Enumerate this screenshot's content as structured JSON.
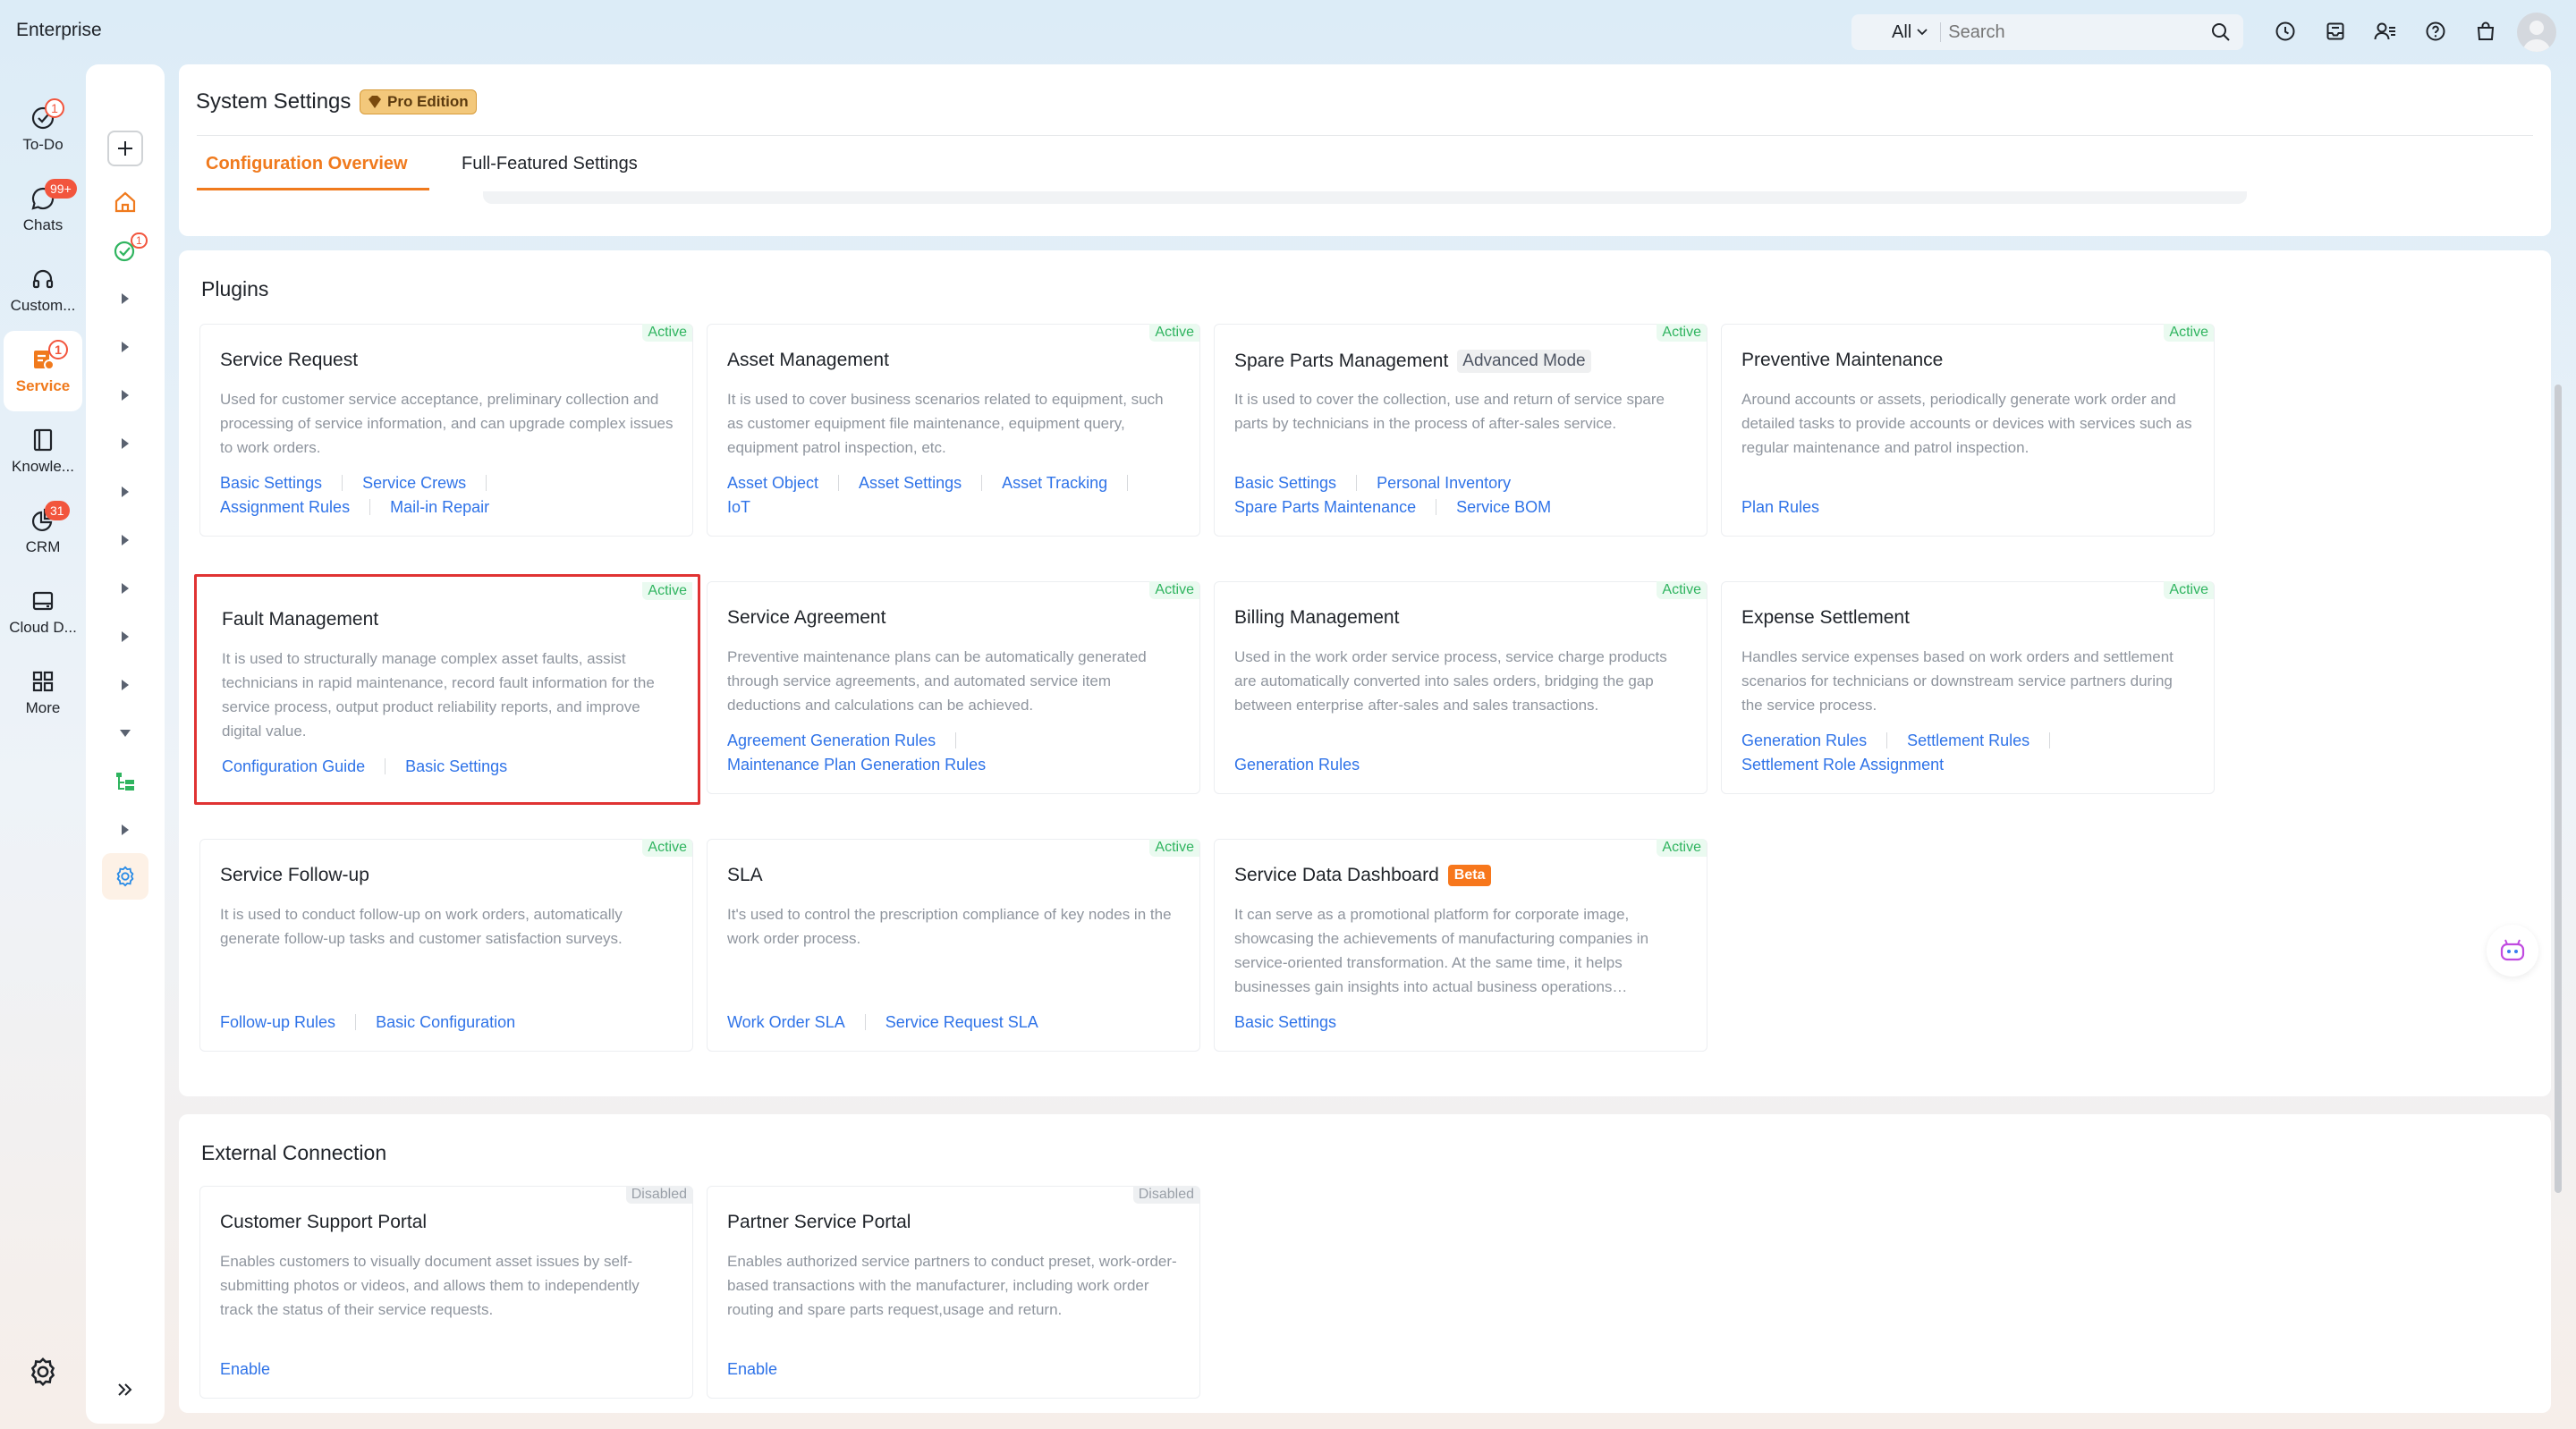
{
  "app": {
    "brand": "Enterprise"
  },
  "search": {
    "scope": "All",
    "placeholder": "Search"
  },
  "nav": {
    "items": [
      {
        "label": "To-Do",
        "badge": "1"
      },
      {
        "label": "Chats",
        "badge": "99+"
      },
      {
        "label": "Custom...",
        "badge": ""
      },
      {
        "label": "Service",
        "badge": "1"
      },
      {
        "label": "Knowle...",
        "badge": ""
      },
      {
        "label": "CRM",
        "badge": "31"
      },
      {
        "label": "Cloud D...",
        "badge": ""
      },
      {
        "label": "More",
        "badge": ""
      }
    ]
  },
  "sidebar2": {
    "todo_badge": "1"
  },
  "page": {
    "title": "System Settings",
    "edition": "Pro Edition",
    "tabs": [
      "Configuration Overview",
      "Full-Featured Settings"
    ]
  },
  "plugins": {
    "title": "Plugins",
    "status_active": "Active",
    "tiles": [
      {
        "title": "Service Request",
        "desc": "Used for customer service acceptance, preliminary collection and processing of service information, and can upgrade complex issues to work orders.",
        "links": [
          "Basic Settings",
          "Service Crews",
          "Assignment Rules",
          "Mail-in Repair"
        ]
      },
      {
        "title": "Asset Management",
        "desc": "It is used to cover business scenarios related to equipment, such as customer equipment file maintenance, equipment query, equipment patrol inspection, etc.",
        "links": [
          "Asset Object",
          "Asset Settings",
          "Asset Tracking",
          "IoT"
        ]
      },
      {
        "title": "Spare Parts Management",
        "mode": "Advanced Mode",
        "desc": "It is used to cover the collection, use and return of service spare parts by technicians in the process of after-sales service.",
        "links": [
          "Basic Settings",
          "Personal Inventory",
          "Spare Parts Maintenance",
          "Service BOM"
        ]
      },
      {
        "title": "Preventive Maintenance",
        "desc": "Around accounts or assets, periodically generate work order and detailed tasks to provide accounts or devices with services such as regular maintenance and patrol inspection.",
        "links": [
          "Plan Rules"
        ]
      },
      {
        "title": "Fault Management",
        "desc": "It is used to structurally manage complex asset faults, assist technicians in rapid maintenance, record fault information for the service process, output product reliability reports, and improve digital value.",
        "links": [
          "Configuration Guide",
          "Basic Settings"
        ]
      },
      {
        "title": "Service Agreement",
        "desc": "Preventive maintenance plans can be automatically generated through service agreements, and automated service item deductions and calculations can be achieved.",
        "links": [
          "Agreement Generation Rules",
          "Maintenance Plan Generation Rules"
        ]
      },
      {
        "title": "Billing Management",
        "desc": "Used in the work order service process, service charge products are automatically converted into sales orders, bridging the gap between enterprise after-sales and sales transactions.",
        "links": [
          "Generation Rules"
        ]
      },
      {
        "title": "Expense Settlement",
        "desc": "Handles service expenses based on work orders and settlement scenarios for technicians or downstream service partners during the service process.",
        "links": [
          "Generation Rules",
          "Settlement Rules",
          "Settlement Role Assignment"
        ]
      },
      {
        "title": "Service Follow-up",
        "desc": "It is used to conduct follow-up on work orders, automatically generate follow-up tasks and customer satisfaction surveys.",
        "links": [
          "Follow-up Rules",
          "Basic Configuration"
        ]
      },
      {
        "title": "SLA",
        "desc": "It's used to control the prescription compliance of key nodes in the work order process.",
        "links": [
          "Work Order SLA",
          "Service Request SLA"
        ]
      },
      {
        "title": "Service Data Dashboard",
        "beta": "Beta",
        "desc": "It can serve as a promotional platform for corporate image, showcasing the achievements of manufacturing companies in service-oriented transformation. At the same time, it helps businesses gain insights into actual business operations…",
        "links": [
          "Basic Settings"
        ]
      }
    ]
  },
  "external": {
    "title": "External Connection",
    "status_disabled": "Disabled",
    "tiles": [
      {
        "title": "Customer Support Portal",
        "desc": "Enables customers to visually document asset issues by self-submitting photos or videos, and allows them to independently track the status of their service requests.",
        "links": [
          "Enable"
        ]
      },
      {
        "title": "Partner Service Portal",
        "desc": "Enables authorized service partners to conduct preset, work-order-based transactions with the manufacturer, including work order routing and spare parts request,usage and return.",
        "links": [
          "Enable"
        ]
      }
    ]
  },
  "colors": {
    "accent": "#f07a1d",
    "link": "#2f73e8",
    "active_green": "#2fb45f",
    "badge_red": "#f2553d",
    "highlight_red": "#e03333"
  }
}
